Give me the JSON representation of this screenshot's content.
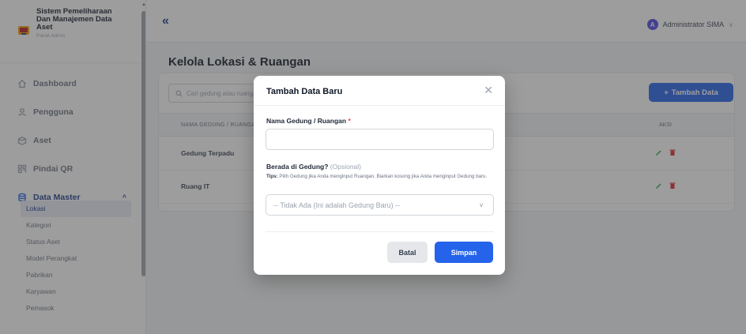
{
  "brand": {
    "title": "Sistem Pemeliharaan Dan Manajemen Data Aset",
    "subtitle": "Panel Admin"
  },
  "sidebar": {
    "items": [
      {
        "label": "Dashboard",
        "icon": "home-icon"
      },
      {
        "label": "Pengguna",
        "icon": "users-icon"
      },
      {
        "label": "Aset",
        "icon": "box-icon"
      },
      {
        "label": "Pindai QR",
        "icon": "qr-icon"
      },
      {
        "label": "Data Master",
        "icon": "database-icon",
        "expanded": true
      }
    ],
    "sub_items": [
      "Lokasi",
      "Kategori",
      "Status Aset",
      "Model Perangkat",
      "Pabrikan",
      "Karyawan",
      "Pemasok"
    ],
    "active_sub": "Lokasi"
  },
  "topbar": {
    "collapse_glyph": "«",
    "avatar_letter": "A",
    "user_name": "Administrator SIMA"
  },
  "page": {
    "title": "Kelola Lokasi & Ruangan",
    "search_placeholder": "Cari gedung atau ruangan...",
    "add_label": "Tambah Data",
    "table": {
      "col_name": "NAMA GEDUNG / RUANGAN",
      "col_actions": "AKSI",
      "rows": [
        "Gedung Terpadu",
        "Ruang IT"
      ]
    }
  },
  "modal": {
    "title": "Tambah Data Baru",
    "field1_label": "Nama Gedung / Ruangan",
    "field1_required": "*",
    "field1_value": "",
    "field2_label": "Berada di Gedung?",
    "field2_optional": "(Opsional)",
    "tips_label": "Tips:",
    "tips_text": "Pilih Gedung jika Anda menginput Ruangan. Biarkan kosong jika Anda menginput Gedung baru.",
    "select_value": "-- Tidak Ada (Ini adalah Gedung Baru) --",
    "cancel_label": "Batal",
    "save_label": "Simpan"
  },
  "colors": {
    "primary": "#2563eb",
    "navy": "#1e3a8a",
    "danger": "#dc2626",
    "edit": "#16a34a",
    "avatar": "#4f46e5"
  }
}
